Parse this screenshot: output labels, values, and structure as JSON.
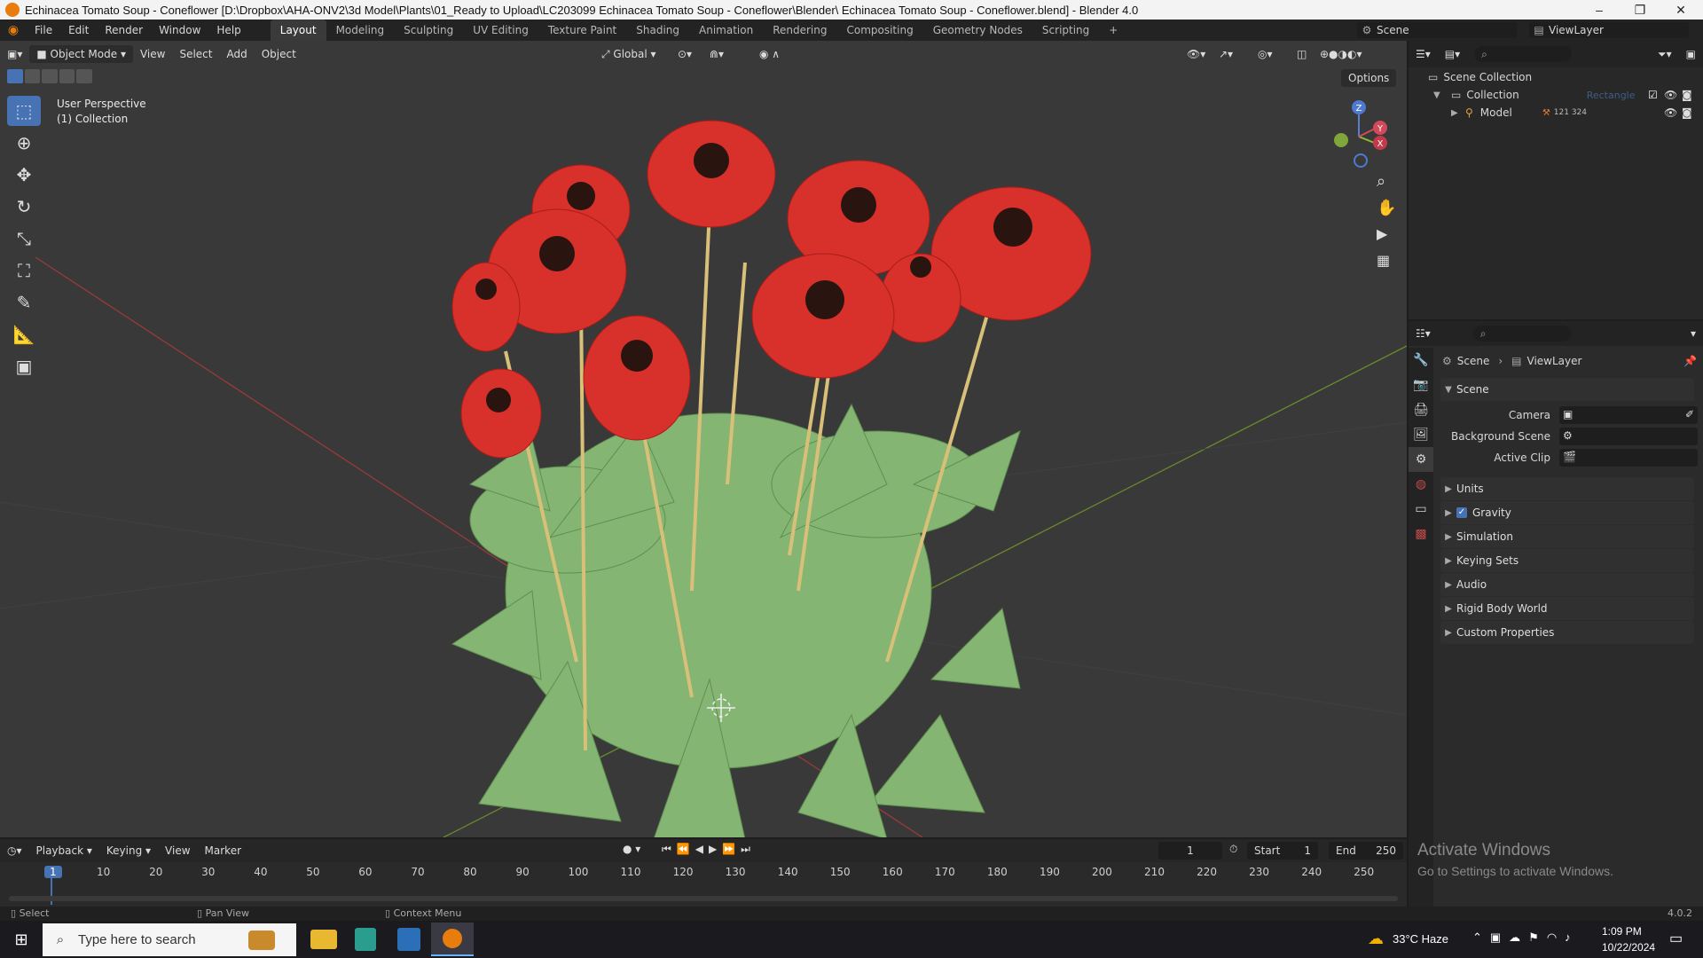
{
  "window": {
    "title": "Echinacea Tomato Soup - Coneflower [D:\\Dropbox\\AHA-ONV2\\3d Model\\Plants\\01_Ready to Upload\\LC203099 Echinacea Tomato Soup - Coneflower\\Blender\\ Echinacea Tomato Soup - Coneflower.blend] - Blender 4.0",
    "minimize": "–",
    "restore": "❐",
    "close": "✕"
  },
  "menu": [
    "File",
    "Edit",
    "Render",
    "Window",
    "Help"
  ],
  "workspaces": [
    "Layout",
    "Modeling",
    "Sculpting",
    "UV Editing",
    "Texture Paint",
    "Shading",
    "Animation",
    "Rendering",
    "Compositing",
    "Geometry Nodes",
    "Scripting",
    "+"
  ],
  "scene_selector": "Scene",
  "viewlayer_selector": "ViewLayer",
  "viewport": {
    "mode": "Object Mode",
    "header_menu": [
      "View",
      "Select",
      "Add",
      "Object"
    ],
    "transform": "Global",
    "options": "Options",
    "overlay_line1": "User Perspective",
    "overlay_line2": "(1) Collection",
    "gizmo_axes": {
      "z": "Z",
      "y": "Y",
      "x": "X"
    }
  },
  "tools": [
    "select-box",
    "cursor",
    "move",
    "rotate",
    "scale",
    "transform",
    "annotate",
    "measure",
    "add-cube"
  ],
  "outliner": {
    "search_placeholder": "",
    "scene_collection": "Scene Collection",
    "collection": "Collection",
    "model": "Model",
    "model_count": "121 324",
    "ghost_label": "Rectangle"
  },
  "properties": {
    "breadcrumb_scene": "Scene",
    "breadcrumb_viewlayer": "ViewLayer",
    "section": "Scene",
    "camera_label": "Camera",
    "background_label": "Background Scene",
    "clip_label": "Active Clip",
    "panels": [
      "Units",
      "Gravity",
      "Simulation",
      "Keying Sets",
      "Audio",
      "Rigid Body World",
      "Custom Properties"
    ],
    "gravity_checked": true
  },
  "timeline": {
    "menus": [
      "Playback",
      "Keying",
      "View",
      "Marker"
    ],
    "current_frame": "1",
    "start_label": "Start",
    "start": "1",
    "end_label": "End",
    "end": "250",
    "ticks": [
      "1",
      "10",
      "20",
      "30",
      "40",
      "50",
      "60",
      "70",
      "80",
      "90",
      "100",
      "110",
      "120",
      "130",
      "140",
      "150",
      "160",
      "170",
      "180",
      "190",
      "200",
      "210",
      "220",
      "230",
      "240",
      "250"
    ]
  },
  "status": {
    "select": "Select",
    "pan": "Pan View",
    "context": "Context Menu",
    "version": "4.0.2"
  },
  "watermark": {
    "line1": "Activate Windows",
    "line2": "Go to Settings to activate Windows."
  },
  "taskbar": {
    "search_placeholder": "Type here to search",
    "weather": "33°C  Haze",
    "time": "1:09 PM",
    "date": "10/22/2024"
  },
  "colors": {
    "accent": "#4772b3",
    "flower": "#d8302a",
    "leaf": "#7fb26a"
  }
}
